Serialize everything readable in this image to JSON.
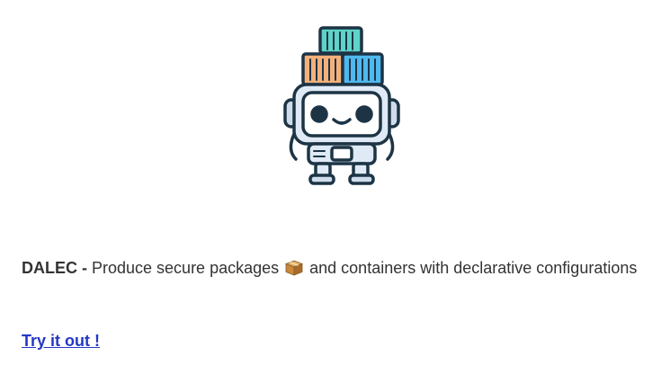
{
  "logo": {
    "icon": "robot-carrying-containers-icon"
  },
  "intro": {
    "brand": "DALEC -",
    "text_before_icon": " Produce secure packages ",
    "inline_icon": "package-icon",
    "text_after_icon": " and containers with declarative configurations"
  },
  "cta": {
    "label": "Try it out !"
  },
  "colors": {
    "text": "#333333",
    "link": "#2337c6",
    "container_teal": "#5fd3c8",
    "container_orange": "#f4b07a",
    "container_blue": "#4fb8ef",
    "robot_body": "#dfeaf6",
    "outline": "#1d3445"
  }
}
